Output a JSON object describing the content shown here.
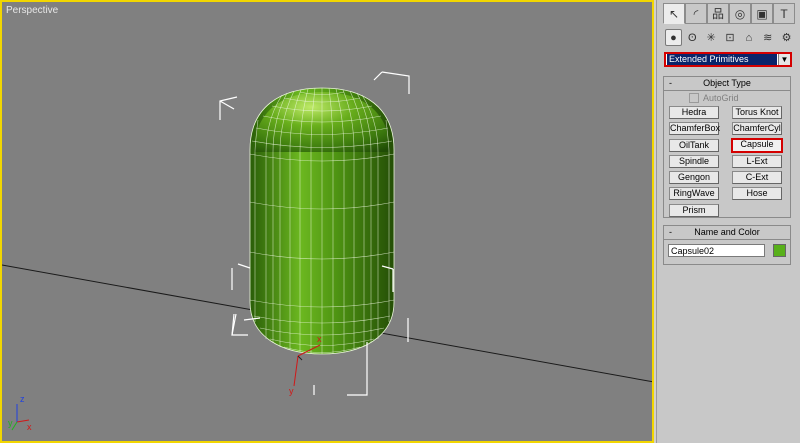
{
  "viewport": {
    "label": "Perspective",
    "axes": {
      "x": "x",
      "y": "y",
      "z": "z"
    },
    "colors": {
      "background": "#808080",
      "border": "#f2d600",
      "object": "#5aa017"
    }
  },
  "command_panel": {
    "tabs": [
      {
        "icon": "arrow-cursor-icon",
        "glyph": "↖",
        "active": true
      },
      {
        "icon": "modify-icon",
        "glyph": "◜",
        "active": false
      },
      {
        "icon": "hierarchy-icon",
        "glyph": "品",
        "active": false
      },
      {
        "icon": "motion-icon",
        "glyph": "◎",
        "active": false
      },
      {
        "icon": "display-icon",
        "glyph": "▣",
        "active": false
      },
      {
        "icon": "utilities-icon",
        "glyph": "T",
        "active": false
      }
    ],
    "subtabs": [
      {
        "icon": "geometry-icon",
        "glyph": "●",
        "active": true
      },
      {
        "icon": "shapes-icon",
        "glyph": "ʘ",
        "active": false
      },
      {
        "icon": "lights-icon",
        "glyph": "✳",
        "active": false
      },
      {
        "icon": "cameras-icon",
        "glyph": "⊡",
        "active": false
      },
      {
        "icon": "helpers-icon",
        "glyph": "⌂",
        "active": false
      },
      {
        "icon": "spacewarps-icon",
        "glyph": "≋",
        "active": false
      },
      {
        "icon": "systems-icon",
        "glyph": "⚙",
        "active": false
      }
    ],
    "category": "Extended Primitives",
    "object_type": {
      "title": "Object Type",
      "collapse": "-",
      "autogrid": "AutoGrid",
      "buttons": [
        {
          "label": "Hedra"
        },
        {
          "label": "Torus Knot"
        },
        {
          "label": "ChamferBox"
        },
        {
          "label": "ChamferCyl"
        },
        {
          "label": "OilTank"
        },
        {
          "label": "Capsule",
          "selected": true
        },
        {
          "label": "Spindle"
        },
        {
          "label": "L-Ext"
        },
        {
          "label": "Gengon"
        },
        {
          "label": "C-Ext"
        },
        {
          "label": "RingWave"
        },
        {
          "label": "Hose"
        },
        {
          "label": "Prism"
        }
      ]
    },
    "name_and_color": {
      "title": "Name and Color",
      "collapse": "-",
      "name_value": "Capsule02",
      "color": "#58b01a"
    }
  }
}
